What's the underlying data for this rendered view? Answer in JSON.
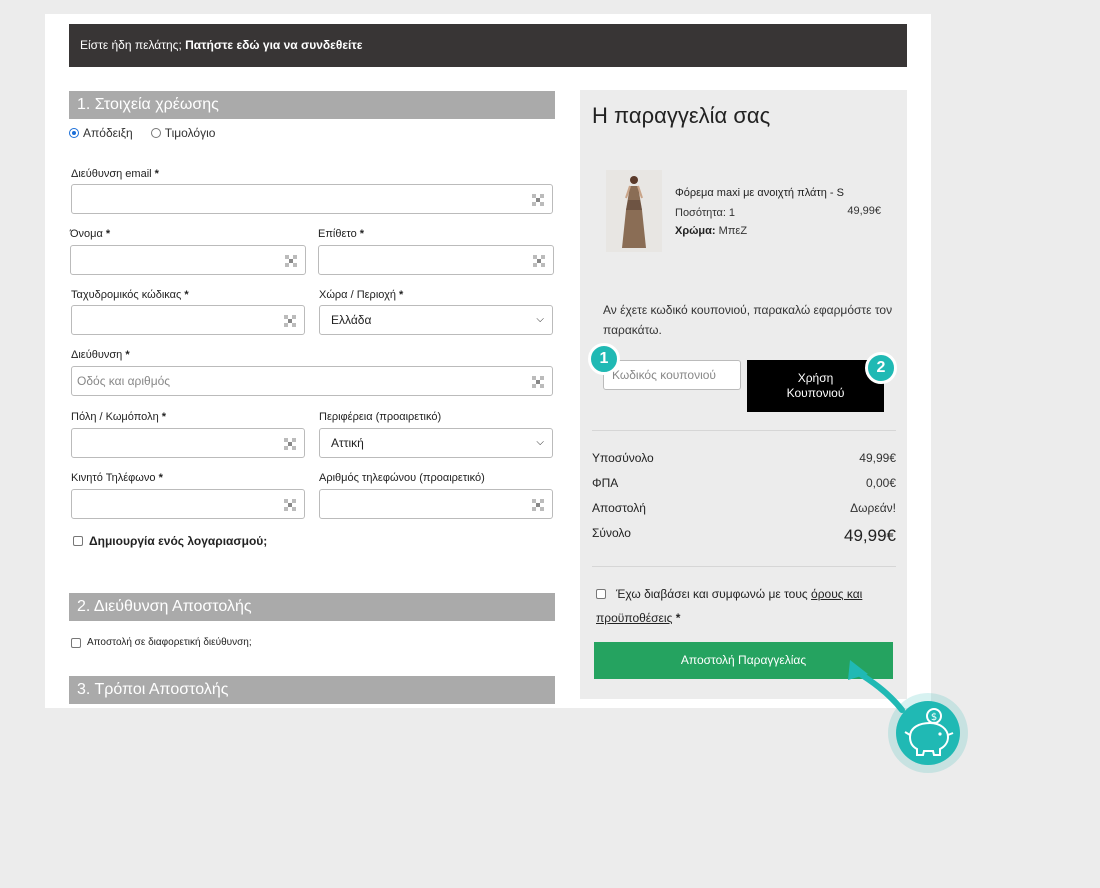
{
  "login_bar": {
    "prefix": "Είστε ήδη πελάτης;",
    "link": "Πατήστε εδώ για να συνδεθείτε"
  },
  "billing": {
    "title": "1. Στοιχεία χρέωσης",
    "doc_type": {
      "receipt": "Απόδειξη",
      "invoice": "Τιμολόγιο",
      "selected": "receipt"
    },
    "email_label": "Διεύθυνση email",
    "first_name_label": "Όνομα",
    "last_name_label": "Επίθετο",
    "postcode_label": "Ταχυδρομικός κώδικας",
    "country_label": "Χώρα / Περιοχή",
    "country_value": "Ελλάδα",
    "address_label": "Διεύθυνση",
    "address_placeholder": "Οδός και αριθμός",
    "city_label": "Πόλη / Κωμόπολη",
    "region_label": "Περιφέρεια (προαιρετικό)",
    "region_value": "Αττική",
    "mobile_label": "Κινητό Τηλέφωνο",
    "phone_label": "Αριθμός τηλεφώνου (προαιρετικό)",
    "create_account": "Δημιουργία ενός λογαριασμού;",
    "required_mark": "*"
  },
  "shipping_address": {
    "title": "2. Διεύθυνση Αποστολής",
    "different_address": "Αποστολή σε διαφορετική διεύθυνση;"
  },
  "shipping_methods": {
    "title": "3. Τρόποι Αποστολής"
  },
  "order": {
    "title": "Η παραγγελία σας",
    "product": {
      "name": "Φόρεμα maxi με ανοιχτή πλάτη - S",
      "qty": "Ποσότητα: 1",
      "price": "49,99€",
      "color_label": "Χρώμα:",
      "color_value": "ΜπεΖ"
    },
    "coupon_note": "Αν έχετε κωδικό κουπονιού, παρακαλώ εφαρμόστε τον παρακάτω.",
    "coupon_placeholder": "Κωδικός κουπονιού",
    "coupon_button": "Χρήση Κουπονιού",
    "totals": [
      {
        "label": "Υποσύνολο",
        "value": "49,99€"
      },
      {
        "label": "ΦΠΑ",
        "value": "0,00€"
      },
      {
        "label": "Αποστολή",
        "value": "Δωρεάν!"
      },
      {
        "label": "Σύνολο",
        "value": "49,99€"
      }
    ],
    "terms_prefix": "Έχω διαβάσει και συμφωνώ με τους",
    "terms_link": "όρους και προϋποθέσεις",
    "terms_required": "*",
    "submit": "Αποστολή Παραγγελίας"
  },
  "annotations": {
    "badge1": "1",
    "badge2": "2",
    "accent": "#20b9b4"
  },
  "colors": {
    "login_bar": "#383535",
    "section_head": "#aaaaaa",
    "submit": "#25a360",
    "coupon_button": "#000000"
  },
  "icons": {
    "field": "autofill-key-icon",
    "select": "chevron-down-icon",
    "piggy": "piggy-bank-icon",
    "arrow": "pointer-arrow-icon"
  }
}
